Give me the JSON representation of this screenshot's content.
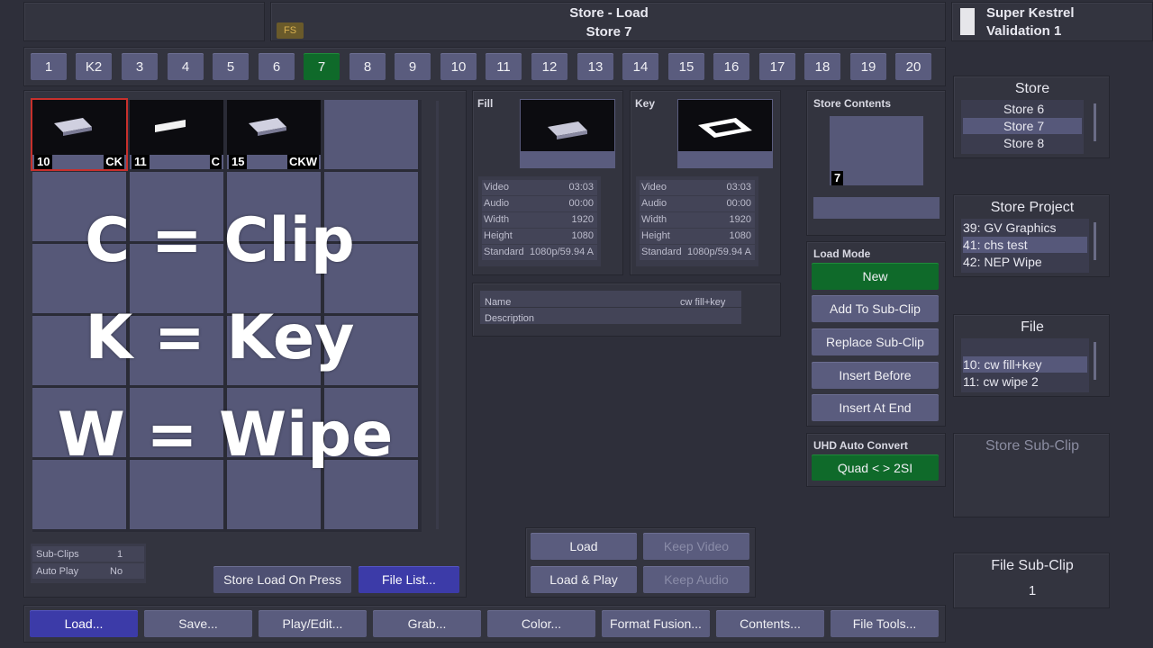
{
  "header": {
    "title_line1": "Store - Load",
    "title_line2": "Store 7",
    "fs_badge": "FS",
    "system_name_line1": "Super Kestrel",
    "system_name_line2": "Validation 1"
  },
  "store_tabs": [
    {
      "label": "1",
      "active": false
    },
    {
      "label": "K2",
      "active": false
    },
    {
      "label": "3",
      "active": false
    },
    {
      "label": "4",
      "active": false
    },
    {
      "label": "5",
      "active": false
    },
    {
      "label": "6",
      "active": false
    },
    {
      "label": "7",
      "active": true
    },
    {
      "label": "8",
      "active": false
    },
    {
      "label": "9",
      "active": false
    },
    {
      "label": "10",
      "active": false
    },
    {
      "label": "11",
      "active": false
    },
    {
      "label": "12",
      "active": false
    },
    {
      "label": "13",
      "active": false
    },
    {
      "label": "14",
      "active": false
    },
    {
      "label": "15",
      "active": false
    },
    {
      "label": "16",
      "active": false
    },
    {
      "label": "17",
      "active": false
    },
    {
      "label": "18",
      "active": false
    },
    {
      "label": "19",
      "active": false
    },
    {
      "label": "20",
      "active": false
    }
  ],
  "clips": [
    {
      "number": "10",
      "type": "CK",
      "selected": true
    },
    {
      "number": "11",
      "type": "C",
      "selected": false
    },
    {
      "number": "15",
      "type": "CKW",
      "selected": false
    }
  ],
  "overlay_legend": [
    "C = Clip",
    "K = Key",
    "W = Wipe"
  ],
  "subclip_info": {
    "subclips_label": "Sub-Clips",
    "subclips_value": "1",
    "autoplay_label": "Auto Play",
    "autoplay_value": "No"
  },
  "fill": {
    "title": "Fill",
    "video_label": "Video",
    "video_value": "03:03",
    "audio_label": "Audio",
    "audio_value": "00:00",
    "width_label": "Width",
    "width_value": "1920",
    "height_label": "Height",
    "height_value": "1080",
    "standard_label": "Standard",
    "standard_value": "1080p/59.94 A"
  },
  "key": {
    "title": "Key",
    "video_label": "Video",
    "video_value": "03:03",
    "audio_label": "Audio",
    "audio_value": "00:00",
    "width_label": "Width",
    "width_value": "1920",
    "height_label": "Height",
    "height_value": "1080",
    "standard_label": "Standard",
    "standard_value": "1080p/59.94 A"
  },
  "clip_meta": {
    "name_label": "Name",
    "name_value": "cw fill+key",
    "description_label": "Description",
    "description_value": ""
  },
  "store_contents": {
    "title": "Store Contents",
    "badge": "7"
  },
  "load_mode": {
    "title": "Load Mode",
    "buttons": [
      "New",
      "Add To Sub-Clip",
      "Replace Sub-Clip",
      "Insert Before",
      "Insert At End"
    ],
    "active": "New"
  },
  "uhd": {
    "title": "UHD Auto Convert",
    "value": "Quad <  > 2SI"
  },
  "store_list": {
    "title": "Store",
    "items": [
      "Store 6",
      "Store 7",
      "Store 8"
    ],
    "selected": "Store 7"
  },
  "store_project": {
    "title": "Store Project",
    "items": [
      {
        "num": "39:",
        "name": "GV Graphics"
      },
      {
        "num": "41:",
        "name": "chs test"
      },
      {
        "num": "42:",
        "name": "NEP Wipe"
      }
    ],
    "selected_index": 1
  },
  "file_list": {
    "title": "File",
    "items": [
      {
        "num": "10:",
        "name": "cw fill+key"
      },
      {
        "num": "11:",
        "name": "cw wipe 2"
      }
    ],
    "selected_index": 0
  },
  "store_subclip": {
    "title": "Store Sub-Clip"
  },
  "file_subclip": {
    "title": "File Sub-Clip",
    "value": "1"
  },
  "actions": {
    "store_load_on_press": "Store Load On Press",
    "file_list": "File List...",
    "load": "Load",
    "keep_video": "Keep Video",
    "load_play": "Load & Play",
    "keep_audio": "Keep Audio"
  },
  "bottom_menu": [
    "Load...",
    "Save...",
    "Play/Edit...",
    "Grab...",
    "Color...",
    "Format Fusion...",
    "Contents...",
    "File Tools..."
  ],
  "colors": {
    "background": "#2e2f3a",
    "button": "#5a5c7e",
    "active_green": "#0f6a2a",
    "active_blue": "#3c3ba8",
    "selected_border": "#c8302c"
  }
}
